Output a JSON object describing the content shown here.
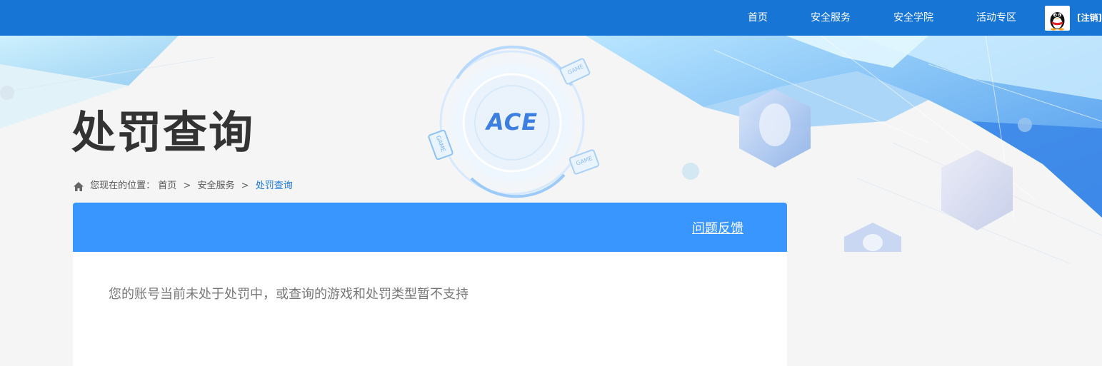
{
  "nav": {
    "items": [
      {
        "label": "首页"
      },
      {
        "label": "安全服务"
      },
      {
        "label": "安全学院"
      },
      {
        "label": "活动专区"
      }
    ],
    "logout_label": "[注销]"
  },
  "page": {
    "title": "处罚查询"
  },
  "breadcrumb": {
    "prefix": "您现在的位置：",
    "items": [
      "首页",
      "安全服务",
      "处罚查询"
    ],
    "separator": ">"
  },
  "panel": {
    "feedback_label": "问题反馈",
    "message": "您的账号当前未处于处罚中，或查询的游戏和处罚类型暂不支持"
  },
  "decor": {
    "logo_text": "ACE",
    "game_label": "GAME"
  },
  "colors": {
    "nav_bg": "#1775d6",
    "panel_header": "#3896fe",
    "title": "#333333",
    "breadcrumb_current": "#1775d6"
  }
}
